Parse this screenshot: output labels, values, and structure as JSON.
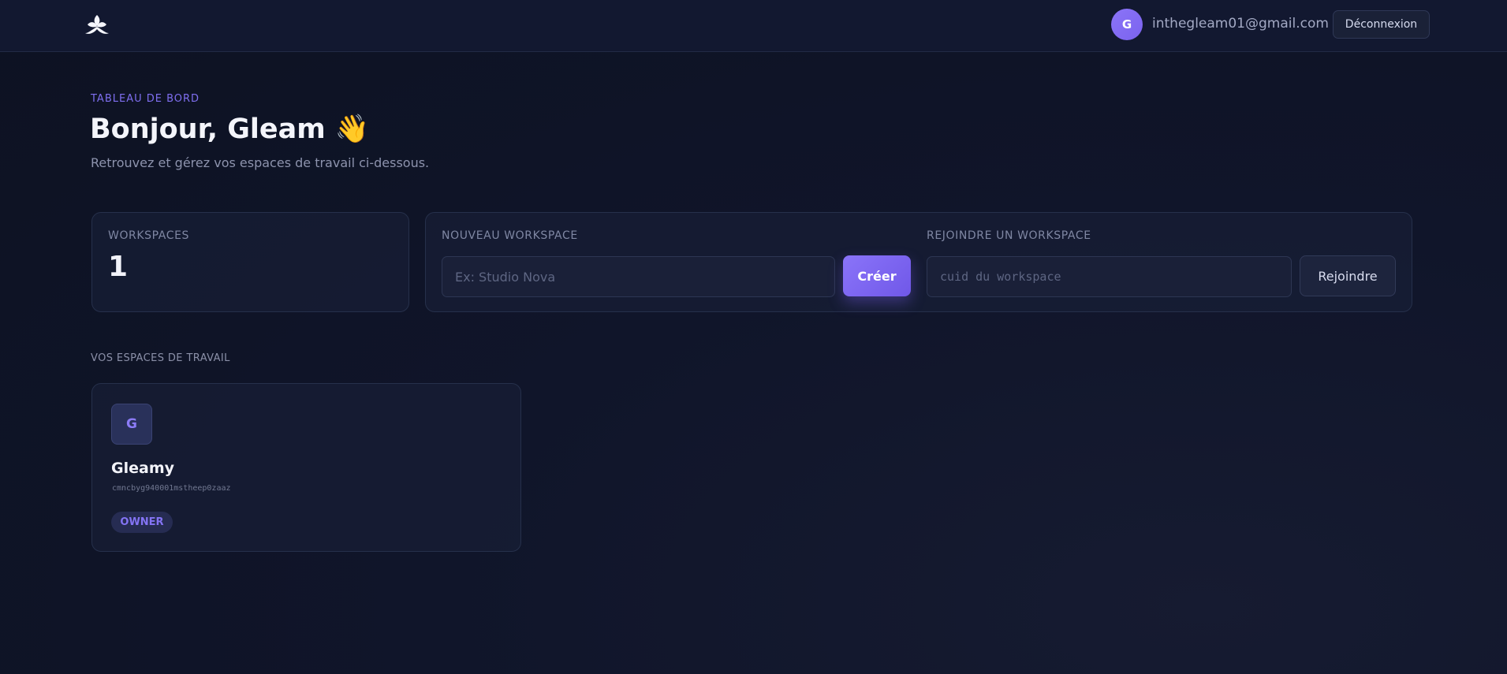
{
  "header": {
    "user": {
      "avatar_initial": "G",
      "email": "inthegleam01@gmail.com"
    },
    "logout_label": "Déconnexion"
  },
  "page": {
    "eyebrow": "TABLEAU DE BORD",
    "title": "Bonjour, Gleam 👋",
    "subtitle": "Retrouvez et gérez vos espaces de travail ci-dessous."
  },
  "stats": {
    "workspaces_label": "WORKSPACES",
    "workspaces_count": "1"
  },
  "create_workspace": {
    "label": "NOUVEAU WORKSPACE",
    "placeholder": "Ex: Studio Nova",
    "button_label": "Créer"
  },
  "join_workspace": {
    "label": "REJOINDRE UN WORKSPACE",
    "placeholder": "cuid du workspace",
    "button_label": "Rejoindre"
  },
  "workspaces_section": {
    "title": "VOS ESPACES DE TRAVAIL",
    "items": [
      {
        "initial": "G",
        "name": "Gleamy",
        "id": "cmncbyg940001mstheep0zaaz",
        "role": "OWNER"
      }
    ]
  },
  "colors": {
    "accent": "#7f6ff0",
    "background": "#10152a"
  },
  "icons": {
    "logo": "lotus-logo-icon"
  }
}
